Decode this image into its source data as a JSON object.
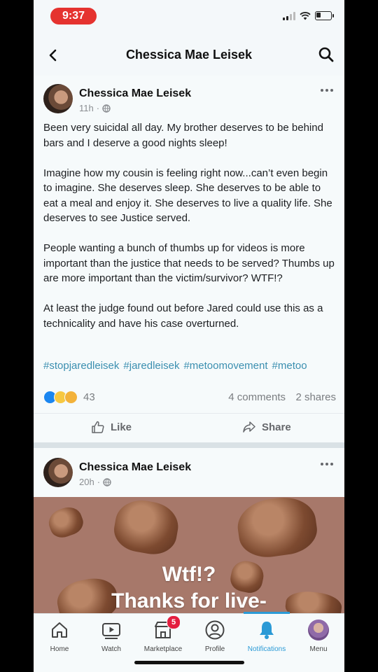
{
  "status_bar": {
    "time": "9:37"
  },
  "header": {
    "title": "Chessica Mae Leisek"
  },
  "posts": [
    {
      "author": "Chessica Mae Leisek",
      "time": "11h",
      "paragraphs": [
        "Been very suicidal all day. My brother deserves to be behind bars and I deserve a good nights sleep!",
        "Imagine how my cousin is feeling right now...can’t even begin to imagine. She deserves sleep. She deserves to be able to eat a meal and enjoy it. She deserves to live a quality life. She deserves to see Justice served.",
        "People wanting a bunch of thumbs up for videos is more important than the justice that needs to be served? Thumbs up are more important than the victim/survivor? WTF!?",
        "At least the judge found out before Jared could use this as a technicality and have his case overturned."
      ],
      "hashtags": [
        "#stopjaredleisek",
        "#jaredleisek",
        "#metoomovement",
        "#metoo"
      ],
      "reaction_count": "43",
      "comments": "4 comments",
      "shares": "2 shares",
      "like_label": "Like",
      "share_label": "Share"
    },
    {
      "author": "Chessica Mae Leisek",
      "time": "20h",
      "media_text_line1": "Wtf!?",
      "media_text_line2": "Thanks for live-"
    }
  ],
  "tabbar": {
    "tabs": [
      {
        "label": "Home",
        "icon": "home-icon"
      },
      {
        "label": "Watch",
        "icon": "watch-icon"
      },
      {
        "label": "Marketplace",
        "icon": "marketplace-icon",
        "badge": "5"
      },
      {
        "label": "Profile",
        "icon": "profile-icon"
      },
      {
        "label": "Notifications",
        "icon": "bell-icon",
        "active": true
      },
      {
        "label": "Menu",
        "icon": "avatar"
      }
    ]
  },
  "colors": {
    "accent": "#2b9ad6",
    "hashtag": "#3b8fb0",
    "badge": "#e41e3f",
    "time_pill": "#e5332f"
  }
}
